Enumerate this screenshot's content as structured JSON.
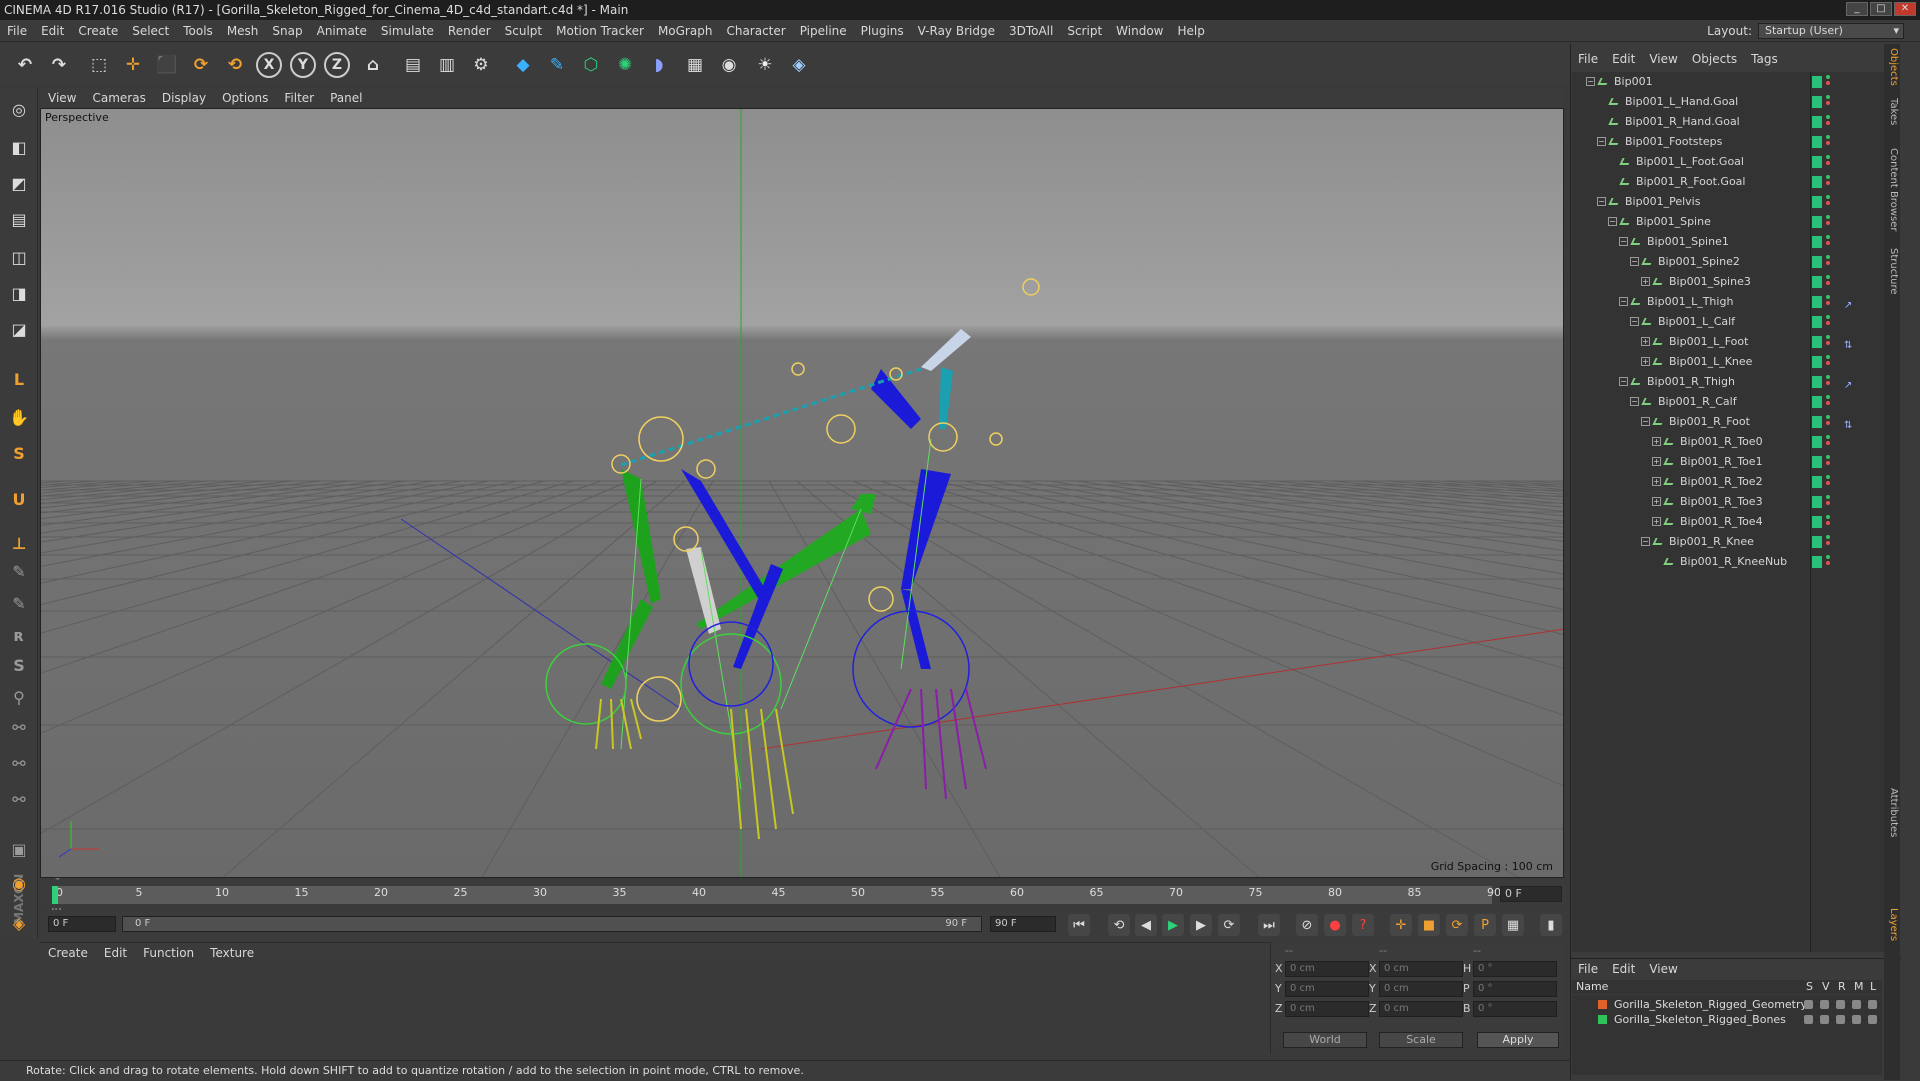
{
  "window": {
    "title": "CINEMA 4D R17.016 Studio (R17) - [Gorilla_Skeleton_Rigged_for_Cinema_4D_c4d_standart.c4d *] - Main",
    "min": "_",
    "max": "□",
    "close": "✕"
  },
  "menubar": [
    "File",
    "Edit",
    "Create",
    "Select",
    "Tools",
    "Mesh",
    "Snap",
    "Animate",
    "Simulate",
    "Render",
    "Sculpt",
    "Motion Tracker",
    "MoGraph",
    "Character",
    "Pipeline",
    "Plugins",
    "V-Ray Bridge",
    "3DToAll",
    "Script",
    "Window",
    "Help"
  ],
  "layout": {
    "label": "Layout:",
    "value": "Startup (User)"
  },
  "toolbar": {
    "icons": [
      "undo-icon",
      "redo-icon",
      "live-select-icon",
      "move-icon",
      "scale-icon",
      "rotate-icon",
      "recent-tool-icon",
      "x-axis-icon",
      "y-axis-icon",
      "z-axis-icon",
      "world-coord-icon",
      "render-view-icon",
      "render-picture-queue-icon",
      "render-settings-icon",
      "cube-icon",
      "pen-spline-icon",
      "subdivision-icon",
      "array-icon",
      "deformer-icon",
      "floor-icon",
      "camera-icon",
      "light-icon",
      "python-icon"
    ],
    "axis_x": "X",
    "axis_y": "Y",
    "axis_z": "Z"
  },
  "lefttools": [
    "make-editable-icon",
    "model-mode-icon",
    "texture-mode-icon",
    "workplane-icon",
    "points-mode-icon",
    "edges-mode-icon",
    "polygons-mode-icon",
    "axis-mode-icon",
    "tweak-icon",
    "solo-icon",
    "snap-icon",
    "workplane-axis-icon",
    "paint-icon",
    "brush-icon",
    "ik-icon",
    "sculpt-icon",
    "pose-icon",
    "joint-icon",
    "rig-icon",
    "weight-icon",
    "lock-icon",
    "render-region-icon",
    "python-script-icon"
  ],
  "maxon": "MAXON CINEMA 4D",
  "viewport": {
    "menu": [
      "View",
      "Cameras",
      "Display",
      "Options",
      "Filter",
      "Panel"
    ],
    "label": "Perspective",
    "grid_spacing": "Grid Spacing : 100 cm"
  },
  "timeline": {
    "ticks": [
      "0",
      "5",
      "10",
      "15",
      "20",
      "25",
      "30",
      "35",
      "40",
      "45",
      "50",
      "55",
      "60",
      "65",
      "70",
      "75",
      "80",
      "85",
      "90"
    ],
    "current_frame": "0 F"
  },
  "playbar": {
    "start": "0 F",
    "range_start": "0 F",
    "range_end": "90 F",
    "end": "90 F"
  },
  "material": {
    "menu": [
      "Create",
      "Edit",
      "Function",
      "Texture"
    ]
  },
  "coords": {
    "headers": [
      "--",
      "--",
      "--"
    ],
    "rows": [
      {
        "a": "X",
        "av": "0 cm",
        "b": "X",
        "bv": "0 cm",
        "c": "H",
        "cv": "0 °"
      },
      {
        "a": "Y",
        "av": "0 cm",
        "b": "Y",
        "bv": "0 cm",
        "c": "P",
        "cv": "0 °"
      },
      {
        "a": "Z",
        "av": "0 cm",
        "b": "Z",
        "bv": "0 cm",
        "c": "B",
        "cv": "0 °"
      }
    ],
    "world": "World",
    "scale": "Scale",
    "apply": "Apply"
  },
  "status": "Rotate: Click and drag to rotate elements. Hold down SHIFT to add to quantize rotation / add to the selection in point mode, CTRL to remove.",
  "objects": {
    "menu": [
      "File",
      "Edit",
      "View",
      "Objects",
      "Tags"
    ],
    "items": [
      {
        "name": "Bip001",
        "depth": 1,
        "exp": "−",
        "tag": ""
      },
      {
        "name": "Bip001_L_Hand.Goal",
        "depth": 2,
        "exp": "",
        "tag": ""
      },
      {
        "name": "Bip001_R_Hand.Goal",
        "depth": 2,
        "exp": "",
        "tag": ""
      },
      {
        "name": "Bip001_Footsteps",
        "depth": 2,
        "exp": "−",
        "tag": ""
      },
      {
        "name": "Bip001_L_Foot.Goal",
        "depth": 3,
        "exp": "",
        "tag": ""
      },
      {
        "name": "Bip001_R_Foot.Goal",
        "depth": 3,
        "exp": "",
        "tag": ""
      },
      {
        "name": "Bip001_Pelvis",
        "depth": 2,
        "exp": "−",
        "tag": ""
      },
      {
        "name": "Bip001_Spine",
        "depth": 3,
        "exp": "−",
        "tag": ""
      },
      {
        "name": "Bip001_Spine1",
        "depth": 4,
        "exp": "−",
        "tag": ""
      },
      {
        "name": "Bip001_Spine2",
        "depth": 5,
        "exp": "−",
        "tag": ""
      },
      {
        "name": "Bip001_Spine3",
        "depth": 6,
        "exp": "+",
        "tag": ""
      },
      {
        "name": "Bip001_L_Thigh",
        "depth": 4,
        "exp": "−",
        "tag": "ik"
      },
      {
        "name": "Bip001_L_Calf",
        "depth": 5,
        "exp": "−",
        "tag": ""
      },
      {
        "name": "Bip001_L_Foot",
        "depth": 6,
        "exp": "+",
        "tag": "ik2"
      },
      {
        "name": "Bip001_L_Knee",
        "depth": 6,
        "exp": "+",
        "tag": ""
      },
      {
        "name": "Bip001_R_Thigh",
        "depth": 4,
        "exp": "−",
        "tag": "ik"
      },
      {
        "name": "Bip001_R_Calf",
        "depth": 5,
        "exp": "−",
        "tag": ""
      },
      {
        "name": "Bip001_R_Foot",
        "depth": 6,
        "exp": "−",
        "tag": "ik2"
      },
      {
        "name": "Bip001_R_Toe0",
        "depth": 7,
        "exp": "+",
        "tag": ""
      },
      {
        "name": "Bip001_R_Toe1",
        "depth": 7,
        "exp": "+",
        "tag": ""
      },
      {
        "name": "Bip001_R_Toe2",
        "depth": 7,
        "exp": "+",
        "tag": ""
      },
      {
        "name": "Bip001_R_Toe3",
        "depth": 7,
        "exp": "+",
        "tag": ""
      },
      {
        "name": "Bip001_R_Toe4",
        "depth": 7,
        "exp": "+",
        "tag": ""
      },
      {
        "name": "Bip001_R_Knee",
        "depth": 6,
        "exp": "−",
        "tag": ""
      },
      {
        "name": "Bip001_R_KneeNub",
        "depth": 7,
        "exp": "",
        "tag": ""
      }
    ]
  },
  "layers": {
    "menu": [
      "File",
      "Edit",
      "View"
    ],
    "head": {
      "name": "Name",
      "s": "S",
      "v": "V",
      "r": "R",
      "m": "M",
      "l": "L"
    },
    "items": [
      {
        "name": "Gorilla_Skeleton_Rigged_Geometry",
        "color": "#e0622a"
      },
      {
        "name": "Gorilla_Skeleton_Rigged_Bones",
        "color": "#2ec45a"
      }
    ]
  },
  "sidetabs": [
    "Objects",
    "Takes",
    "Content Browser",
    "Structure",
    "Attributes",
    "Layers"
  ],
  "colors": {
    "accent": "#f0a030",
    "layer_green": "#29c07a",
    "viewport_bg": "#8a8a8a"
  }
}
